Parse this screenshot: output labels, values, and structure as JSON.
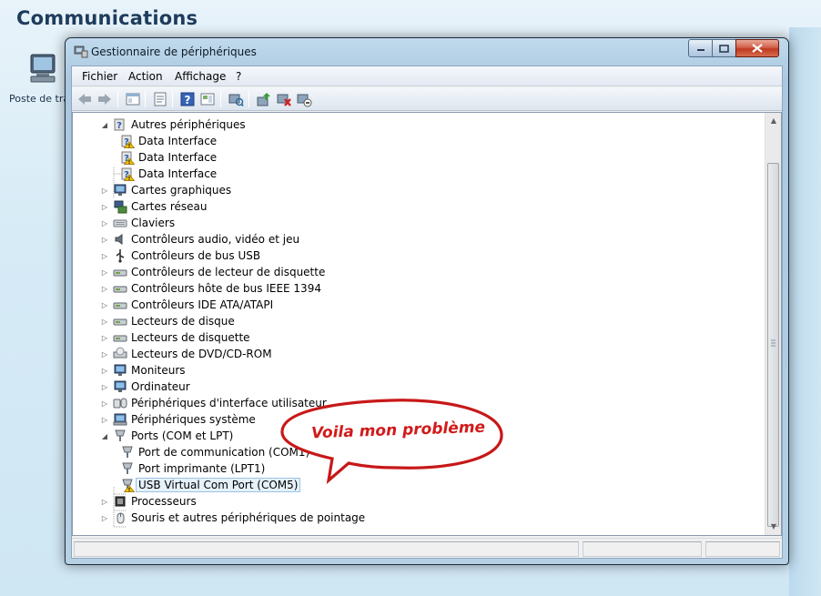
{
  "background": {
    "heading": "Communications",
    "desktop_icon_name": "computer-icon",
    "desktop_icon_label": "Poste de travail"
  },
  "window": {
    "title": "Gestionnaire de périphériques",
    "menu": [
      "Fichier",
      "Action",
      "Affichage",
      "?"
    ],
    "toolbar_icons": [
      "back-icon",
      "forward-icon",
      "show-hide-tree-icon",
      "properties-icon",
      "help-icon",
      "view-icon",
      "scan-hardware-icon",
      "update-driver-icon",
      "uninstall-icon",
      "disable-icon"
    ]
  },
  "tree": [
    {
      "label": "Autres périphériques",
      "level": 0,
      "expanded": true,
      "icon": "other-devices-icon"
    },
    {
      "label": "Data Interface",
      "level": 1,
      "warning": true,
      "icon": "unknown-device-warning-icon"
    },
    {
      "label": "Data Interface",
      "level": 1,
      "warning": true,
      "icon": "unknown-device-warning-icon"
    },
    {
      "label": "Data Interface",
      "level": 1,
      "warning": true,
      "icon": "unknown-device-warning-icon"
    },
    {
      "label": "Cartes graphiques",
      "level": 0,
      "icon": "display-adapter-icon"
    },
    {
      "label": "Cartes réseau",
      "level": 0,
      "icon": "network-adapter-icon"
    },
    {
      "label": "Claviers",
      "level": 0,
      "icon": "keyboard-icon"
    },
    {
      "label": "Contrôleurs audio, vidéo et jeu",
      "level": 0,
      "icon": "audio-icon"
    },
    {
      "label": "Contrôleurs de bus USB",
      "level": 0,
      "icon": "usb-icon"
    },
    {
      "label": "Contrôleurs de lecteur de disquette",
      "level": 0,
      "icon": "floppy-controller-icon"
    },
    {
      "label": "Contrôleurs hôte de bus IEEE 1394",
      "level": 0,
      "icon": "ieee1394-icon"
    },
    {
      "label": "Contrôleurs IDE ATA/ATAPI",
      "level": 0,
      "icon": "ide-controller-icon"
    },
    {
      "label": "Lecteurs de disque",
      "level": 0,
      "icon": "disk-drive-icon"
    },
    {
      "label": "Lecteurs de disquette",
      "level": 0,
      "icon": "floppy-drive-icon"
    },
    {
      "label": "Lecteurs de DVD/CD-ROM",
      "level": 0,
      "icon": "dvd-drive-icon"
    },
    {
      "label": "Moniteurs",
      "level": 0,
      "icon": "monitor-icon"
    },
    {
      "label": "Ordinateur",
      "level": 0,
      "icon": "computer-icon"
    },
    {
      "label": "Périphériques d'interface utilisateur",
      "level": 0,
      "icon": "hid-icon"
    },
    {
      "label": "Périphériques système",
      "level": 0,
      "icon": "system-device-icon"
    },
    {
      "label": "Ports (COM et LPT)",
      "level": 0,
      "expanded": true,
      "icon": "port-icon"
    },
    {
      "label": "Port de communication (COM1)",
      "level": 1,
      "icon": "port-icon"
    },
    {
      "label": "Port imprimante (LPT1)",
      "level": 1,
      "icon": "port-icon"
    },
    {
      "label": "USB Virtual Com Port (COM5)",
      "level": 1,
      "warning": true,
      "selected": true,
      "icon": "port-warning-icon"
    },
    {
      "label": "Processeurs",
      "level": 0,
      "icon": "processor-icon"
    },
    {
      "label": "Souris et autres périphériques de pointage",
      "level": 0,
      "icon": "mouse-icon"
    }
  ],
  "annotation": {
    "text": "Voila mon problème",
    "color": "#d21a1a"
  },
  "colors": {
    "selection_bg": "#e5f1fb",
    "selection_border": "#9ac3e7",
    "warning": "#f5c400"
  }
}
